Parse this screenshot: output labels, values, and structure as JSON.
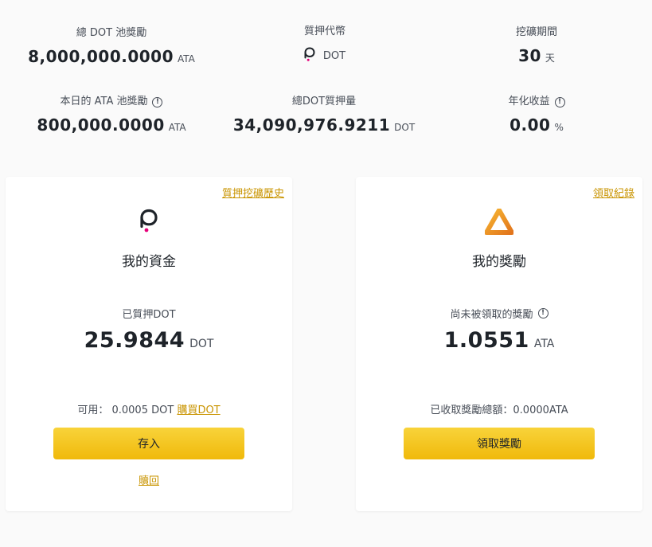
{
  "stats": {
    "pool_total": {
      "label": "總 DOT 池獎勵",
      "value": "8,000,000.0000",
      "unit": "ATA"
    },
    "staking_token": {
      "label": "質押代幣",
      "token": "DOT"
    },
    "mining_period": {
      "label": "挖礦期間",
      "value": "30",
      "unit": "天"
    },
    "daily_pool": {
      "label": "本日的 ATA 池獎勵",
      "value": "800,000.0000",
      "unit": "ATA"
    },
    "total_staked": {
      "label": "總DOT質押量",
      "value": "34,090,976.9211",
      "unit": "DOT"
    },
    "apy": {
      "label": "年化收益",
      "value": "0.00",
      "unit": "%"
    }
  },
  "funds_card": {
    "history_link": "質押挖礦歷史",
    "title": "我的資金",
    "staked_label": "已質押DOT",
    "staked_value": "25.9844",
    "staked_unit": "DOT",
    "available_prefix": "可用： 0.0005 DOT",
    "buy_link": "購買DOT",
    "deposit_button": "存入",
    "redeem_link": "贖回"
  },
  "rewards_card": {
    "records_link": "領取紀錄",
    "title": "我的獎勵",
    "unclaimed_label": "尚未被領取的獎勵",
    "unclaimed_value": "1.0551",
    "unclaimed_unit": "ATA",
    "claimed_total": "已收取獎勵總額：0.0000ATA",
    "claim_button": "領取獎勵"
  },
  "colors": {
    "background": "#fafafa",
    "accent": "#f0b90b",
    "link": "#c99400",
    "polkadot_pink": "#e6007a",
    "ata_orange": "#e8921a"
  },
  "icons": {
    "polkadot": "polkadot-logo-icon",
    "ata": "ata-logo-icon",
    "info": "info-icon"
  }
}
